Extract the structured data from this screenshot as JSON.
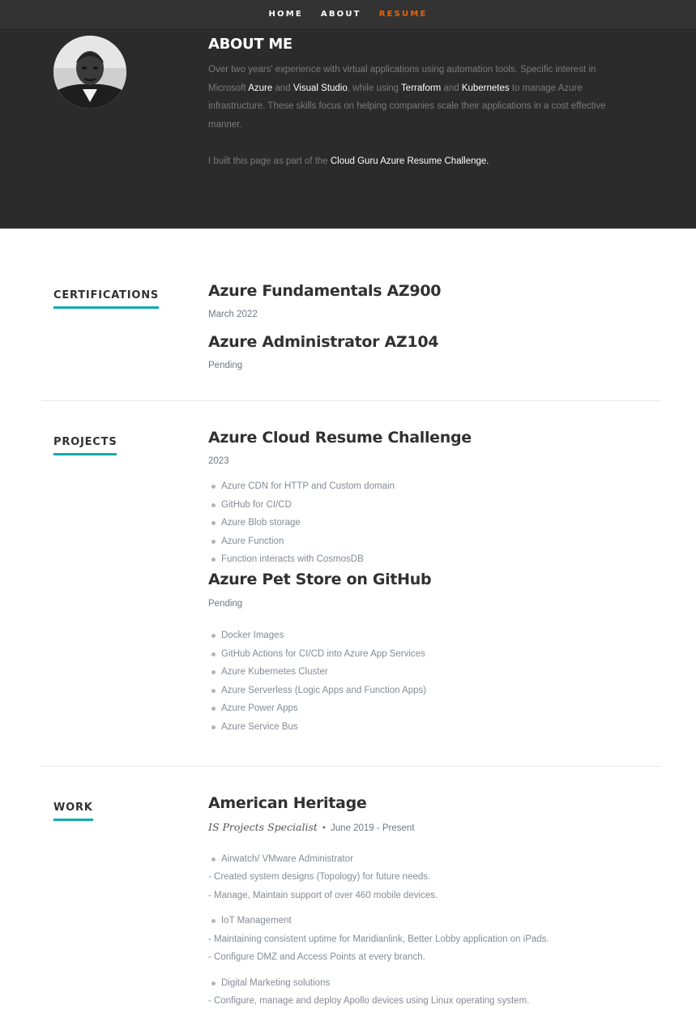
{
  "nav": {
    "items": [
      {
        "label": "HOME",
        "active": false
      },
      {
        "label": "ABOUT",
        "active": false
      },
      {
        "label": "RESUME",
        "active": true
      }
    ],
    "accent_color": "#F06000"
  },
  "about": {
    "title": "ABOUT ME",
    "p1_a": "Over two years' experience with virtual applications using automation tools. Specific interest in Microsoft ",
    "kw_azure": "Azure",
    "p1_b": " and ",
    "kw_vs": "Visual Studio",
    "p1_c": ", while using ",
    "kw_tf": "Terraform",
    "p1_d": " and ",
    "kw_k8s": "Kubernetes",
    "p1_e": " to manage Azure infrastructure. These skills focus on helping companies scale their applications in a cost effective manner.",
    "p2_a": "I built this page as part of the ",
    "p2_link": "Cloud Guru Azure Resume Challenge."
  },
  "certifications": {
    "label": "CERTIFICATIONS",
    "items": [
      {
        "title": "Azure Fundamentals AZ900",
        "date": "March 2022"
      },
      {
        "title": "Azure Administrator AZ104",
        "date": "Pending"
      }
    ]
  },
  "projects": {
    "label": "PROJECTS",
    "items": [
      {
        "title": "Azure Cloud Resume Challenge",
        "date": "2023",
        "bullets": [
          "Azure CDN for HTTP and Custom domain",
          "GitHub for CI/CD",
          "Azure Blob storage",
          "Azure Function",
          "Function interacts with CosmosDB"
        ]
      },
      {
        "title": "Azure Pet Store on GitHub",
        "date": "Pending",
        "bullets": [
          "Docker Images",
          "GitHub Actions for CI/CD into Azure App Services",
          "Azure Kubernetes Cluster",
          "Azure Serverless (Logic Apps and Function Apps)",
          "Azure Power Apps",
          "Azure Service Bus"
        ]
      }
    ]
  },
  "work": {
    "label": "WORK",
    "company": "American Heritage",
    "role": "IS Projects Specialist",
    "separator": "•",
    "dates": "June 2019 - Present",
    "groups": [
      {
        "bullet": "Airwatch/ VMware Administrator",
        "lines": [
          "- Created system designs (Topology) for future needs.",
          "- Manage, Maintain support of over 460 mobile devices."
        ]
      },
      {
        "bullet": "IoT Management",
        "lines": [
          "- Maintaining consistent uptime for Maridianlink, Better Lobby application on iPads.",
          "- Configure DMZ and Access Points at every branch."
        ]
      },
      {
        "bullet": "Digital Marketing solutions",
        "lines": [
          "- Configure, manage and deploy Apollo devices using Linux operating system."
        ]
      }
    ]
  },
  "colors": {
    "teal_underline": "#11ABB0",
    "dark_header": "#2B2B2B"
  }
}
